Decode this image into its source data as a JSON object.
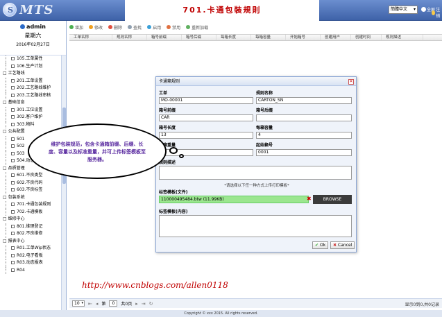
{
  "header": {
    "logo_glyph": "S",
    "app_title": "MTS",
    "page_heading": "701.卡通包裝規則",
    "language": "簡體中文",
    "fullscreen_label": "全屏",
    "logout_label": "注销"
  },
  "sidebar": {
    "user": "admin",
    "weekday": "星期六",
    "date": "2016年02月27日",
    "tree": [
      {
        "type": "leaf",
        "label": "105.工单属性"
      },
      {
        "type": "leaf",
        "label": "106.生产计划"
      },
      {
        "type": "group",
        "label": "工艺路线"
      },
      {
        "type": "leaf",
        "label": "201.工单设置"
      },
      {
        "type": "leaf",
        "label": "202.工艺路线维护"
      },
      {
        "type": "leaf",
        "label": "203.工艺路线审核"
      },
      {
        "type": "group",
        "label": "基础信息"
      },
      {
        "type": "leaf",
        "label": "301.工位设置"
      },
      {
        "type": "leaf",
        "label": "302.客户维护"
      },
      {
        "type": "leaf",
        "label": "303.物料"
      },
      {
        "type": "group",
        "label": "公共配置"
      },
      {
        "type": "leaf",
        "label": "501"
      },
      {
        "type": "leaf",
        "label": "502"
      },
      {
        "type": "leaf",
        "label": "503"
      },
      {
        "type": "leaf",
        "label": "504.动态数据"
      },
      {
        "type": "group",
        "label": "品质管理"
      },
      {
        "type": "leaf",
        "label": "601.不良类型"
      },
      {
        "type": "leaf",
        "label": "602.不良代码"
      },
      {
        "type": "leaf",
        "label": "603.不良标签"
      },
      {
        "type": "group",
        "label": "包装系统"
      },
      {
        "type": "leaf",
        "label": "701.卡通包装规则"
      },
      {
        "type": "leaf",
        "label": "702.卡通模板"
      },
      {
        "type": "group",
        "label": "维修中心"
      },
      {
        "type": "leaf",
        "label": "801.维理登记"
      },
      {
        "type": "leaf",
        "label": "802.不良维修"
      },
      {
        "type": "group",
        "label": "报表中心"
      },
      {
        "type": "leaf",
        "label": "R01.工单Wip状态"
      },
      {
        "type": "leaf",
        "label": "R02.电子看板"
      },
      {
        "type": "leaf",
        "label": "R03.动态报表"
      },
      {
        "type": "leaf",
        "label": "R04"
      }
    ]
  },
  "toolbar": {
    "add": "增加",
    "edit": "修改",
    "delete": "删除",
    "search": "查找",
    "enable": "启用",
    "disable": "禁用",
    "reload": "重新加载"
  },
  "grid": {
    "columns": [
      "工单名称",
      "规则名称",
      "箱号前缀",
      "箱号后缀",
      "每箱长度",
      "每箱容量",
      "开始箱号",
      "创建用户",
      "创建时间",
      "规则描述"
    ]
  },
  "dialog": {
    "title": "卡通箱规则",
    "close_glyph": "✕",
    "order_label": "工单",
    "order_value": "MO-00001",
    "rule_name_label": "规则名称",
    "rule_name_value": "CARTON_SN",
    "prefix_label": "箱号前缀",
    "prefix_value": "CAR",
    "suffix_label": "箱号后缀",
    "suffix_value": "",
    "length_label": "箱号长度",
    "length_value": "13",
    "capacity_label": "每箱容量",
    "capacity_value": "4",
    "weight_label": "单箱重量",
    "weight_value": "",
    "start_label": "起始箱号",
    "start_value": "0001",
    "desc_label": "规则描述",
    "hint": "*请选择以下任一种方式上传打印模板*",
    "file_label": "标签模板(文件)",
    "file_value": "110000495484.btw (11.99KB)",
    "file_delete_glyph": "✖",
    "browse": "BROWSE",
    "content_label": "标签模板(内容)",
    "ok": "Ok",
    "cancel": "Cancel"
  },
  "callout": {
    "text": "维护包装规范，包含卡通箱前缀、后缀、长度、容量以及标准重量，并可上传标签模板至服务器。"
  },
  "watermark": "http://www.cnblogs.com/allen0118",
  "pager": {
    "page_size": "10",
    "page_prefix": "第",
    "page_value": "0",
    "page_suffix": "共0页",
    "info": "显示0到0,共0记录"
  },
  "footer": "Copyright © xxx 2015. All rights reserved."
}
